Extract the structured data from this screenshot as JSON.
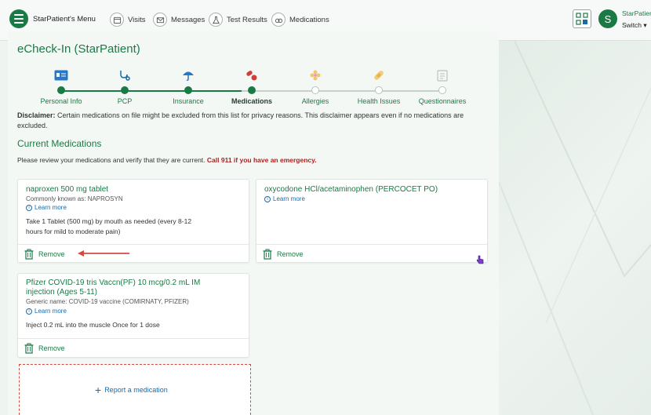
{
  "topbar": {
    "menu_label": "StarPatient's Menu",
    "nav": [
      {
        "label": "Visits",
        "icon": "calendar-icon"
      },
      {
        "label": "Messages",
        "icon": "envelope-icon"
      },
      {
        "label": "Test Results",
        "icon": "flask-icon"
      },
      {
        "label": "Medications",
        "icon": "pills-icon"
      }
    ],
    "avatar_initial": "S",
    "account_name": "StarPatier",
    "switch_label": "Switch"
  },
  "page": {
    "title": "eCheck-In (StarPatient)"
  },
  "stepper": {
    "steps": [
      {
        "label": "Personal Info",
        "icon": "id-card-icon",
        "state": "done"
      },
      {
        "label": "PCP",
        "icon": "stethoscope-icon",
        "state": "done"
      },
      {
        "label": "Insurance",
        "icon": "umbrella-icon",
        "state": "done"
      },
      {
        "label": "Medications",
        "icon": "pills-icon",
        "state": "current"
      },
      {
        "label": "Allergies",
        "icon": "flower-icon",
        "state": "todo"
      },
      {
        "label": "Health Issues",
        "icon": "bandage-icon",
        "state": "todo"
      },
      {
        "label": "Questionnaires",
        "icon": "clipboard-icon",
        "state": "todo"
      }
    ]
  },
  "disclaimer": {
    "label": "Disclaimer:",
    "text": " Certain medications on file might be excluded from this list for privacy reasons. This disclaimer appears even if no medications are excluded."
  },
  "current_meds": {
    "title": "Current Medications",
    "instructions": "Please review your medications and verify that they are current. ",
    "emergency": "Call 911 if you have an emergency.",
    "cards": [
      {
        "name": "naproxen 500 mg tablet",
        "sub": "Commonly known as: NAPROSYN",
        "learn_more": "Learn more",
        "desc_line1": "Take 1 Tablet (500 mg) by mouth as needed (every 8-12",
        "desc_line2": "hours for mild to moderate pain)",
        "remove": "Remove"
      },
      {
        "name": "oxycodone HCl/acetaminophen (PERCOCET PO)",
        "learn_more": "Learn more",
        "remove": "Remove"
      },
      {
        "name_line1": "Pfizer COVID-19 tris Vaccn(PF) 10 mcg/0.2 mL IM",
        "name_line2": "injection (Ages 5-11)",
        "sub": "Generic name: COVID-19 vaccine (COMIRNATY, PFIZER)",
        "learn_more": "Learn more",
        "desc_line1": "Inject 0.2 mL into the muscle Once for 1 dose",
        "remove": "Remove"
      }
    ],
    "report_label": "Report a medication"
  },
  "colors": {
    "brand_green": "#1a7a45",
    "link_blue": "#1a6aa8",
    "emergency_red": "#b0201e",
    "annotation_red": "#d24a42"
  }
}
